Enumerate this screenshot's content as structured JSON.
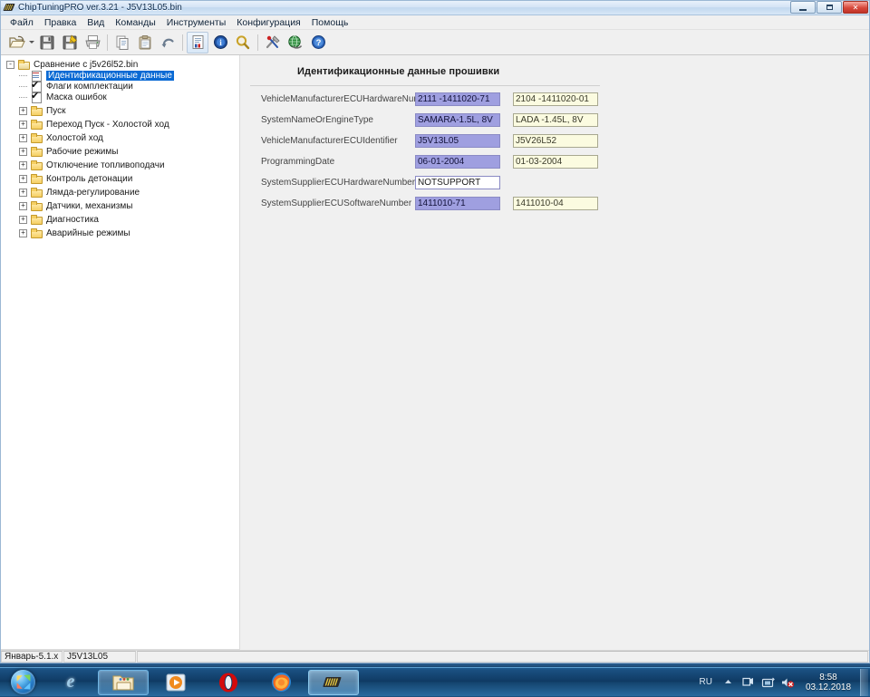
{
  "window": {
    "title": "ChipTuningPRO ver.3.21 - J5V13L05.bin",
    "icon": "chip-icon",
    "minimize_label": "Minimize",
    "maximize_label": "Maximize",
    "close_label": "Close"
  },
  "menubar": {
    "items": [
      {
        "label": "Файл",
        "name": "menu-file"
      },
      {
        "label": "Правка",
        "name": "menu-edit"
      },
      {
        "label": "Вид",
        "name": "menu-view"
      },
      {
        "label": "Команды",
        "name": "menu-commands"
      },
      {
        "label": "Инструменты",
        "name": "menu-tools"
      },
      {
        "label": "Конфигурация",
        "name": "menu-configuration"
      },
      {
        "label": "Помощь",
        "name": "menu-help"
      }
    ]
  },
  "toolbar": {
    "buttons": [
      {
        "name": "open-file-button",
        "icon": "open-folder-icon",
        "label": "Открыть"
      },
      {
        "name": "open-dropdown-button",
        "icon": "chevron-down-icon",
        "label": "Открыть (список)"
      },
      {
        "name": "save-button",
        "icon": "floppy-disk-icon",
        "label": "Сохранить"
      },
      {
        "name": "save-as-button",
        "icon": "floppy-disk-edit-icon",
        "label": "Сохранить как"
      },
      {
        "name": "print-button",
        "icon": "printer-icon",
        "label": "Печать"
      },
      {
        "name": "copy-button",
        "icon": "copy-icon",
        "label": "Копировать"
      },
      {
        "name": "paste-button",
        "icon": "clipboard-icon",
        "label": "Вставить"
      },
      {
        "name": "undo-button",
        "icon": "undo-arrow-icon",
        "label": "Отменить"
      },
      {
        "name": "compare-button",
        "icon": "document-compare-icon",
        "label": "Сравнение"
      },
      {
        "name": "info-button",
        "icon": "info-circle-icon",
        "label": "Информация"
      },
      {
        "name": "search-button",
        "icon": "magnifier-icon",
        "label": "Поиск"
      },
      {
        "name": "tools-button",
        "icon": "wrench-screwdriver-icon",
        "label": "Инструменты"
      },
      {
        "name": "web-button",
        "icon": "globe-icon",
        "label": "Интернет"
      },
      {
        "name": "help-button",
        "icon": "question-circle-icon",
        "label": "Справка"
      }
    ]
  },
  "tree": {
    "root": {
      "label": "Сравнение с j5v26l52.bin",
      "icon": "open-folder-icon",
      "expander": "-"
    },
    "children": [
      {
        "label": "Идентификационные данные",
        "icon": "document-red-icon",
        "selected": true
      },
      {
        "label": "Флаги комплектации",
        "icon": "checklist-icon",
        "selected": false
      },
      {
        "label": "Маска ошибок",
        "icon": "checklist-icon",
        "selected": false
      }
    ],
    "groups": [
      {
        "label": "Пуск",
        "expander": "+"
      },
      {
        "label": "Переход Пуск - Холостой ход",
        "expander": "+"
      },
      {
        "label": "Холостой ход",
        "expander": "+"
      },
      {
        "label": "Рабочие режимы",
        "expander": "+"
      },
      {
        "label": "Отключение топливоподачи",
        "expander": "+"
      },
      {
        "label": "Контроль детонации",
        "expander": "+"
      },
      {
        "label": "Лямда-регулирование",
        "expander": "+"
      },
      {
        "label": "Датчики, механизмы",
        "expander": "+"
      },
      {
        "label": "Диагностика",
        "expander": "+"
      },
      {
        "label": "Аварийные режимы",
        "expander": "+"
      }
    ]
  },
  "content": {
    "title": "Идентификационные данные прошивки",
    "rows": [
      {
        "label": "VehicleManufacturerECUHardwareNumber",
        "left": "2111 -1411020-71",
        "right": "2104 -1411020-01",
        "left_style": "highlight"
      },
      {
        "label": "SystemNameOrEngineType",
        "left": "SAMARA-1.5L, 8V",
        "right": "LADA -1.45L, 8V",
        "left_style": "highlight"
      },
      {
        "label": "VehicleManufacturerECUIdentifier",
        "left": "J5V13L05",
        "right": "J5V26L52",
        "left_style": "highlight"
      },
      {
        "label": "ProgrammingDate",
        "left": "06-01-2004",
        "right": "01-03-2004",
        "left_style": "highlight"
      },
      {
        "label": "SystemSupplierECUHardwareNumber",
        "left": "NOTSUPPORT",
        "right": "",
        "left_style": "plain"
      },
      {
        "label": "SystemSupplierECUSoftwareNumber",
        "left": "1411010-71",
        "right": "1411010-04",
        "left_style": "highlight"
      }
    ]
  },
  "statusbar": {
    "panel1": "Январь-5.1.x",
    "panel2": "J5V13L05",
    "panel3": ""
  },
  "taskbar": {
    "start_label": "Пуск",
    "buttons": [
      {
        "name": "taskbar-internet-explorer",
        "icon": "internet-explorer-icon",
        "label": "Internet Explorer",
        "state": "normal"
      },
      {
        "name": "taskbar-file-explorer",
        "icon": "folder-explorer-icon",
        "label": "Проводник",
        "state": "pinned"
      },
      {
        "name": "taskbar-media-player",
        "icon": "media-player-icon",
        "label": "Проигрыватель Windows Media",
        "state": "normal"
      },
      {
        "name": "taskbar-opera",
        "icon": "opera-icon",
        "label": "Opera",
        "state": "normal"
      },
      {
        "name": "taskbar-firefox",
        "icon": "firefox-icon",
        "label": "Mozilla Firefox",
        "state": "normal"
      },
      {
        "name": "taskbar-chiptuningpro",
        "icon": "chip-icon",
        "label": "ChipTuningPRO",
        "state": "running"
      }
    ],
    "tray": {
      "language": "RU",
      "show_hidden_label": "Отображать скрытые значки",
      "icons": [
        {
          "name": "network-icon",
          "label": "Сеть"
        },
        {
          "name": "removable-media-icon",
          "label": "Безопасное извлечение устройств"
        },
        {
          "name": "volume-muted-icon",
          "label": "Громкость (выключено)"
        }
      ],
      "time": "8:58",
      "date": "03.12.2018"
    }
  },
  "colors": {
    "accent": "#0a6ad4",
    "left_field_bg": "#9f9fe0",
    "right_field_bg": "#fbfbe0",
    "taskbar": "#0f3a63"
  }
}
